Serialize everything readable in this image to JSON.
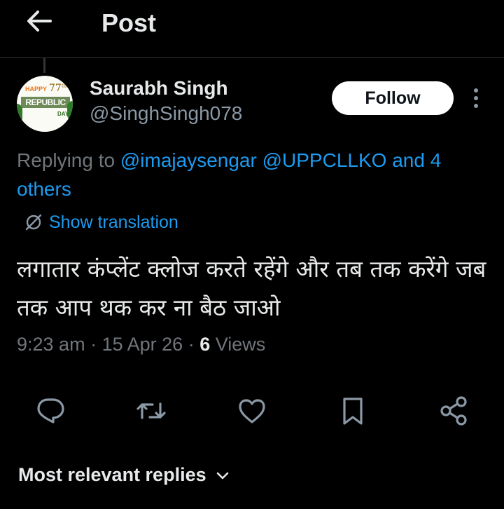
{
  "header": {
    "title": "Post",
    "back_icon": "arrow-left-icon"
  },
  "author": {
    "name": "Saurabh Singh",
    "handle": "@SinghSingh078",
    "avatar_text": {
      "top": "HAPPY",
      "number": "77",
      "number_suffix": "th",
      "middle": "REPUBLIC",
      "bottom": "DAY"
    }
  },
  "follow_label": "Follow",
  "replying": {
    "prefix": "Replying to",
    "mentions": [
      "@imajaysengar",
      "@UPPCLLKO"
    ],
    "suffix": "and 4 others"
  },
  "translation_label": "Show translation",
  "tweet_text": "लगातार कंप्लेंट क्लोज करते रहेंगे और तब तक करेंगे जब तक आप थक कर ना बैठ जाओ",
  "meta": {
    "time": "9:23 am",
    "date": "15 Apr 26",
    "views_count": "6",
    "views_label": "Views",
    "sep": "·"
  },
  "actions": [
    "reply-icon",
    "retweet-icon",
    "like-icon",
    "bookmark-icon",
    "share-icon"
  ],
  "replies_filter": {
    "label": "Most relevant replies",
    "icon": "chevron-down-icon"
  },
  "colors": {
    "background": "#000000",
    "accent": "#1d9bf0",
    "secondary_text": "#71767b",
    "primary_text": "#e7e9ea"
  }
}
